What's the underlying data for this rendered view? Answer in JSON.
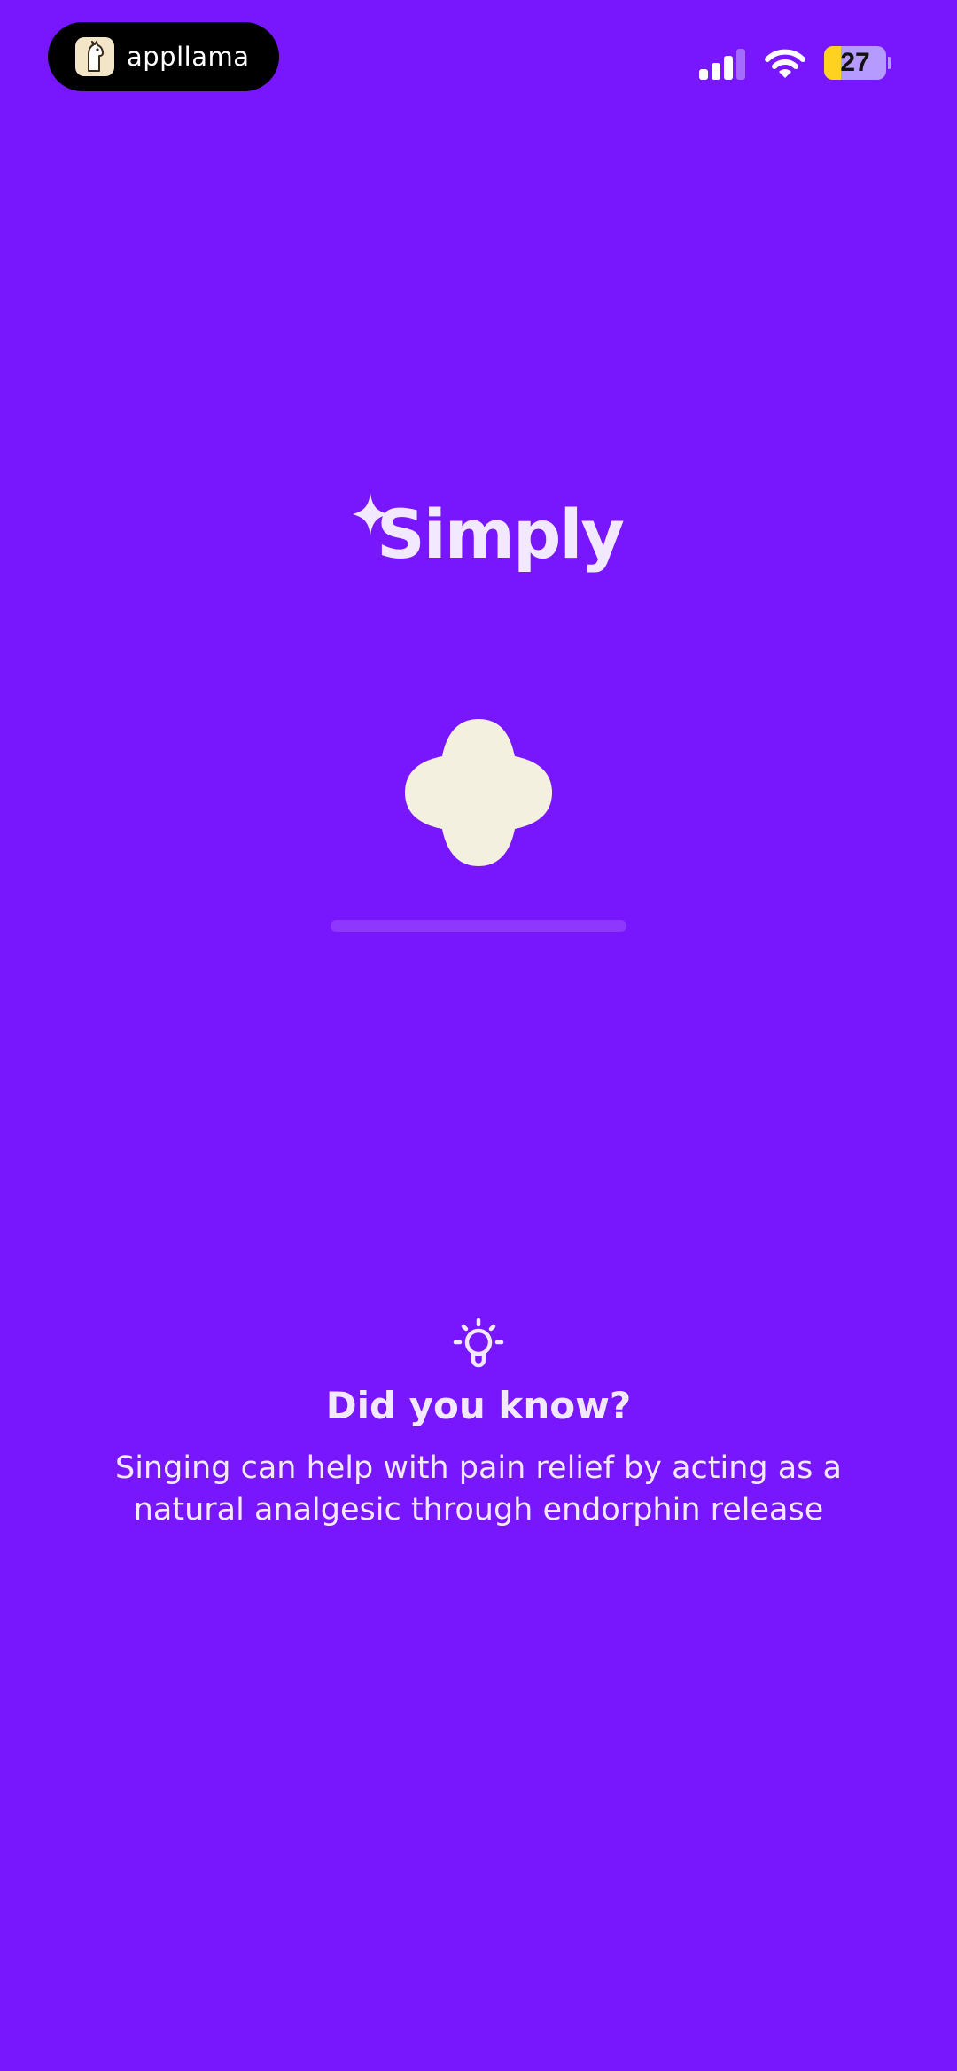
{
  "status_bar": {
    "app_badge_label": "appllama",
    "battery_level": "27",
    "battery_fraction": 0.27,
    "icons": [
      "llama-icon",
      "cellular-signal-icon",
      "wifi-icon",
      "battery-icon"
    ]
  },
  "brand": {
    "logo_text": "Simply",
    "logo_icon": "sparkle-icon"
  },
  "loading": {
    "shape_icon": "blob-loader-icon",
    "progress_fraction": 0.0
  },
  "tip": {
    "icon": "lightbulb-icon",
    "title": "Did you know?",
    "body": "Singing can help with pain relief by acting as a natural analgesic through endorphin release"
  },
  "colors": {
    "background": "#7816FE",
    "text": "#F2E8FF",
    "loader_shape": "#F4F0DF",
    "progress_track": "#8E38FF",
    "battery_fill": "#FFD21F"
  }
}
